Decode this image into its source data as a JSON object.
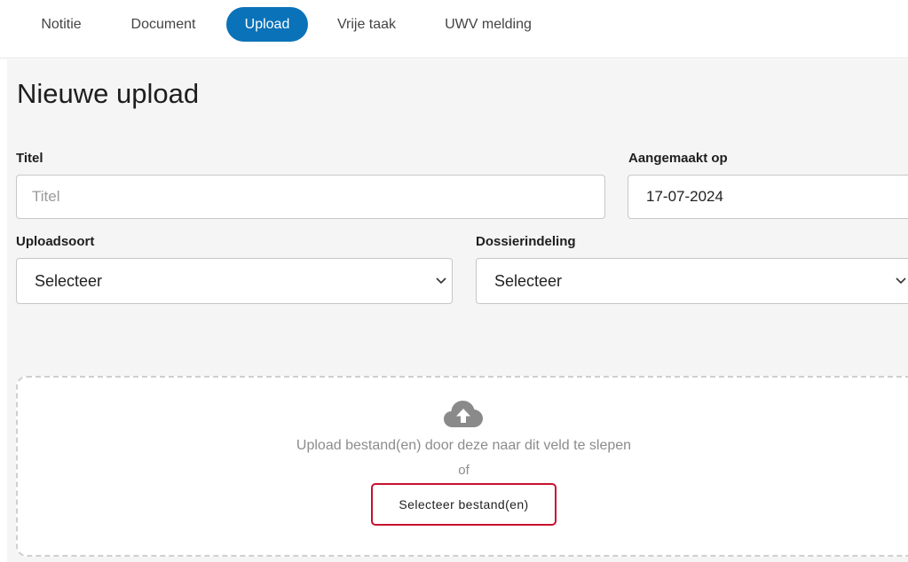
{
  "tabs": [
    {
      "label": "Notitie",
      "active": false
    },
    {
      "label": "Document",
      "active": false
    },
    {
      "label": "Upload",
      "active": true
    },
    {
      "label": "Vrije taak",
      "active": false
    },
    {
      "label": "UWV melding",
      "active": false
    }
  ],
  "form": {
    "heading": "Nieuwe upload",
    "title": {
      "label": "Titel",
      "value": "",
      "placeholder": "Titel"
    },
    "created": {
      "label": "Aangemaakt op",
      "value": "17-07-2024"
    },
    "upload_type": {
      "label": "Uploadsoort",
      "selected": "Selecteer"
    },
    "file_plan": {
      "label": "Dossierindeling",
      "selected": "Selecteer"
    }
  },
  "dropzone": {
    "icon": "cloud-upload-icon",
    "instruction": "Upload bestand(en) door deze naar dit veld te slepen",
    "or": "of",
    "button_label": "Selecteer bestand(en)"
  },
  "colors": {
    "accent": "#0a72b8",
    "button_border": "#c8102e",
    "panel_background": "#f5f5f5"
  }
}
